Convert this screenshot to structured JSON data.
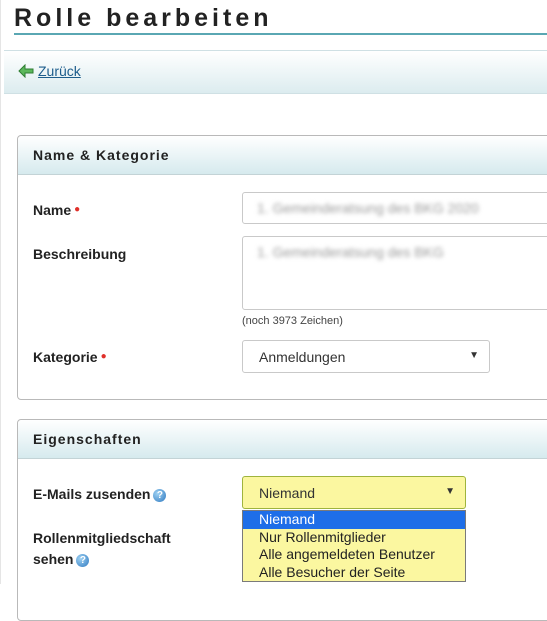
{
  "page": {
    "title": "Rolle bearbeiten"
  },
  "nav": {
    "back_label": "Zurück"
  },
  "section_name": {
    "header": "Name & Kategorie",
    "name_label": "Name",
    "name_value": "1. Gemeinderatsung des BKG 2020",
    "description_label": "Beschreibung",
    "description_value": "1. Gemeinderatsung des BKG",
    "char_hint": "(noch 3973 Zeichen)",
    "category_label": "Kategorie",
    "category_value": "Anmeldungen"
  },
  "section_properties": {
    "header": "Eigenschaften",
    "emails_label": "E-Mails zusenden",
    "emails_value": "Niemand",
    "membership_label_line1": "Rollenmitgliedschaft",
    "membership_label_line2": "sehen",
    "dropdown_options": [
      "Niemand",
      "Nur Rollenmitglieder",
      "Alle angemeldeten Benutzer",
      "Alle Besucher der Seite"
    ]
  },
  "colors": {
    "accent": "#5aa7b3",
    "link": "#1d5d8c",
    "required": "#e0302a",
    "select_highlight": "#fbf7a0",
    "selected_option": "#1e6ee8"
  }
}
